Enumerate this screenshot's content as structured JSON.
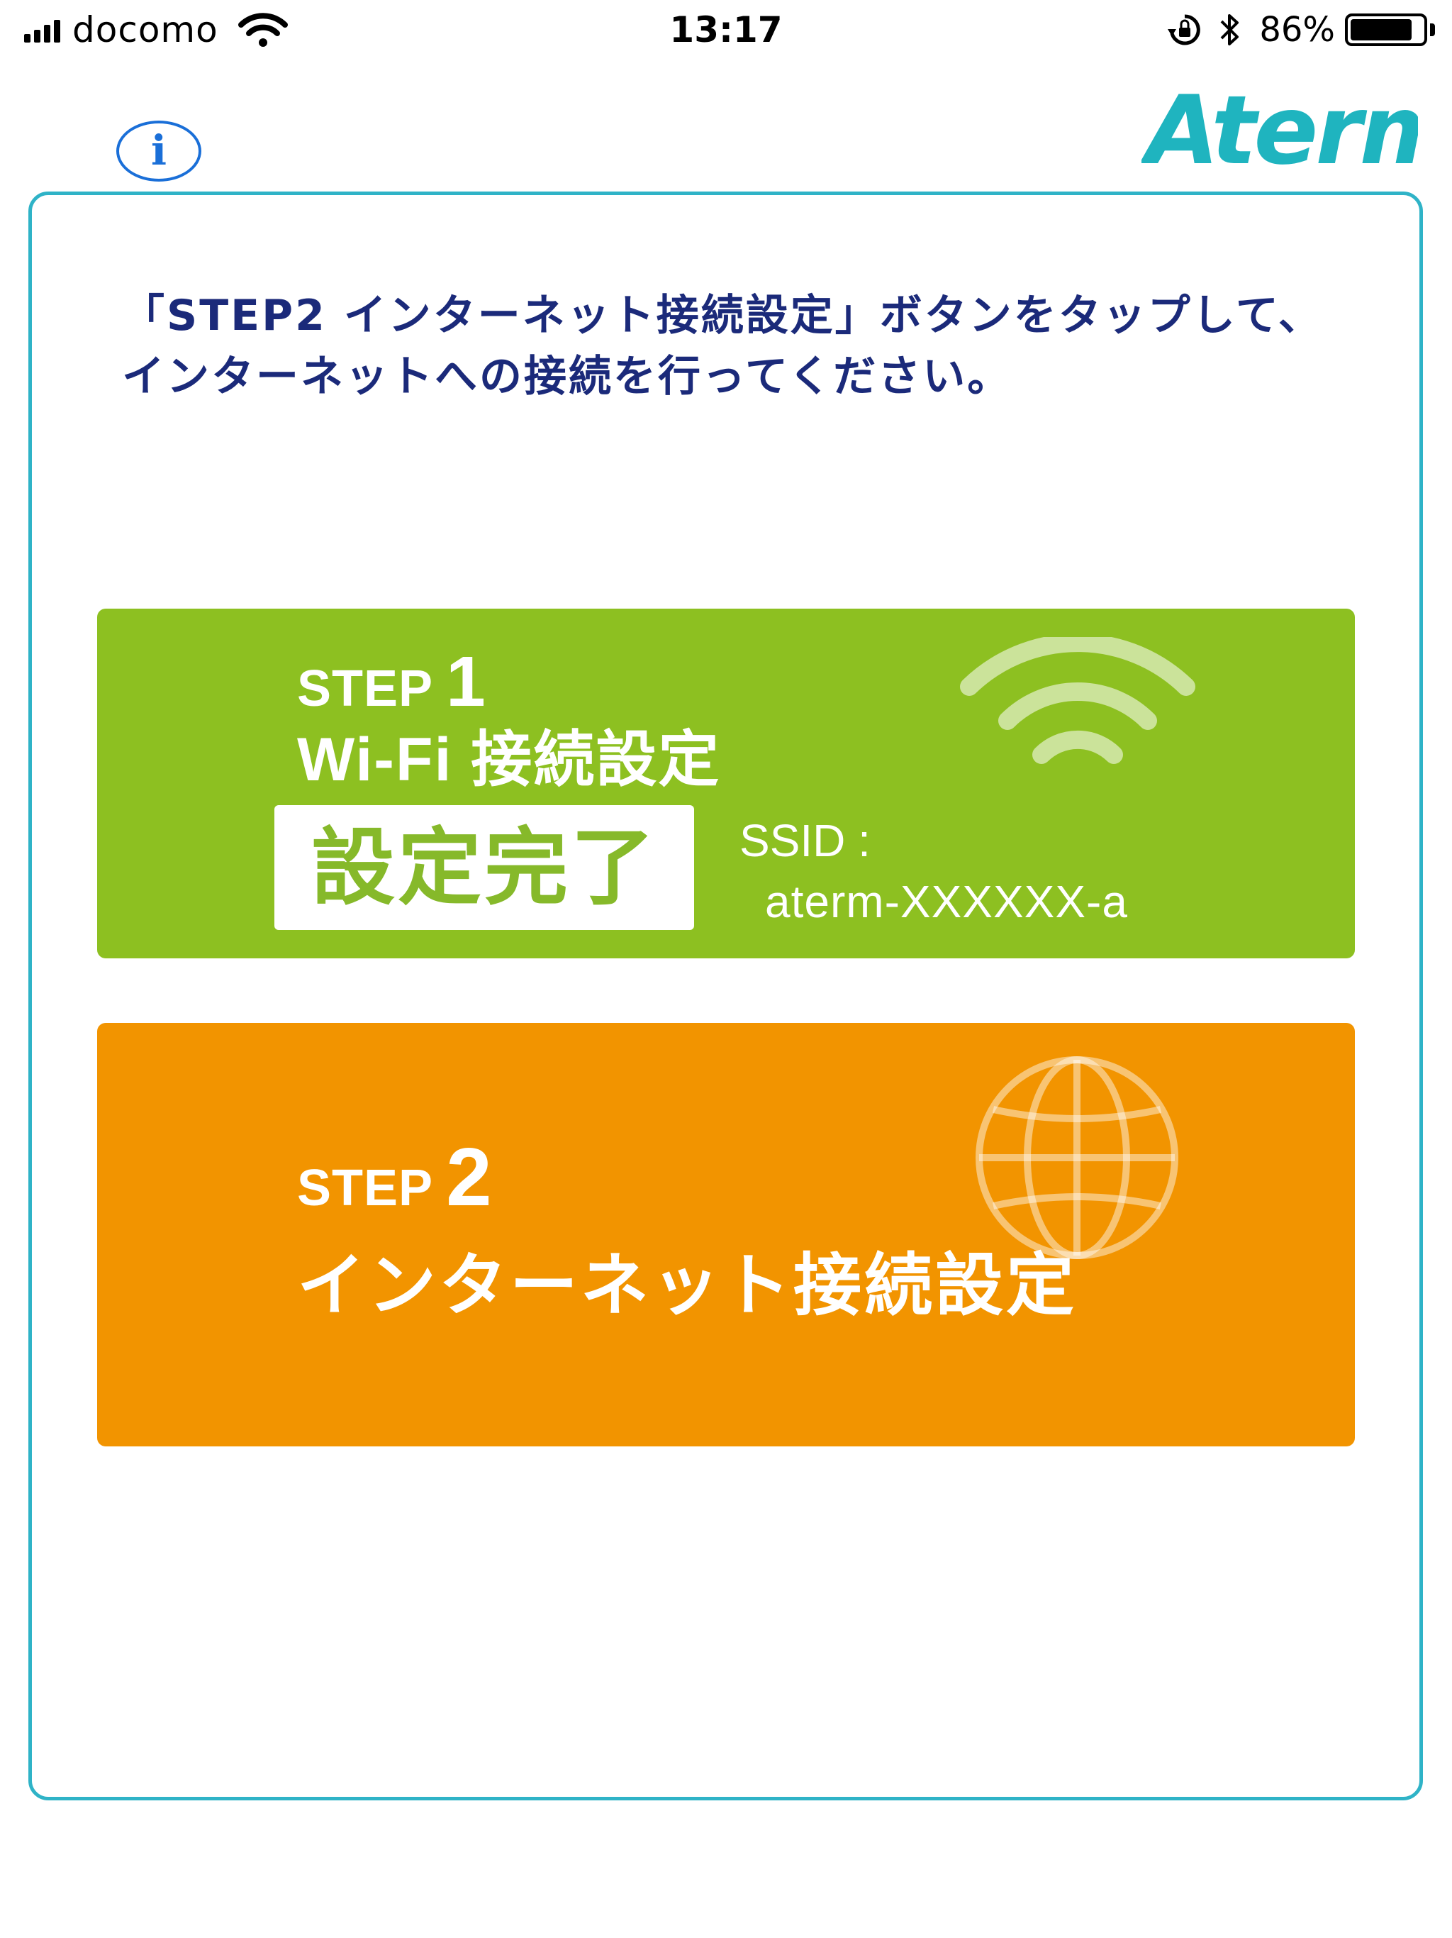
{
  "status_bar": {
    "carrier": "docomo",
    "time": "13:17",
    "battery_percent": "86%",
    "battery_level": 0.86,
    "icons": [
      "signal-icon",
      "wifi-icon",
      "rotation-lock-icon",
      "bluetooth-icon",
      "battery-icon"
    ]
  },
  "header": {
    "info_glyph": "i",
    "logo_text": "Aterm"
  },
  "instruction": "「STEP2 インターネット接続設定」ボタンをタップして、インターネットへの接続を行ってください。",
  "step1": {
    "step_word": "STEP",
    "step_number": "1",
    "title": "Wi-Fi 接続設定",
    "status_badge": "設定完了",
    "ssid_label": "SSID :",
    "ssid_value": "aterm-XXXXXX-a",
    "icon": "wifi-icon",
    "color": "#8dc021"
  },
  "step2": {
    "step_word": "STEP",
    "step_number": "2",
    "title": "インターネット接続設定",
    "icon": "globe-icon",
    "color": "#f29400"
  },
  "colors": {
    "card_border": "#2fb3c7",
    "instruction_text": "#1b2a7a",
    "info_button": "#1a6fd8",
    "logo": "#1fb4bf"
  }
}
